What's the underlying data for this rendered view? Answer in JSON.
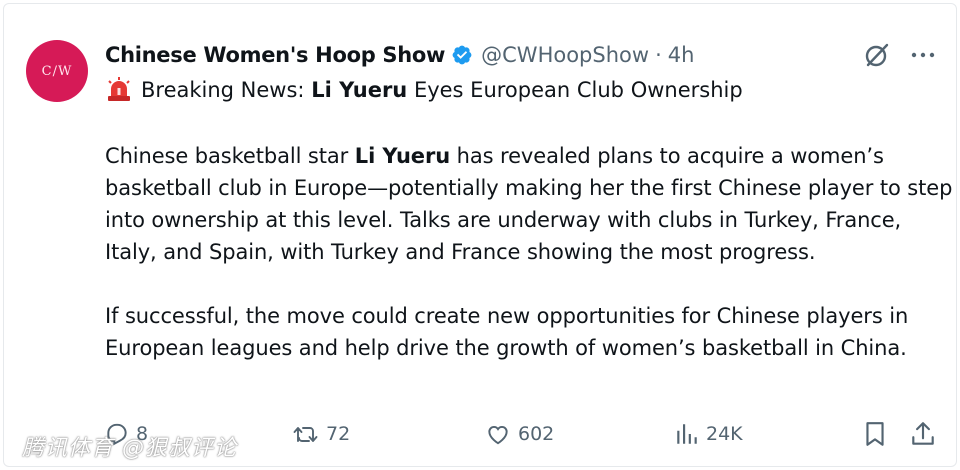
{
  "tweet": {
    "avatar_text": "C/W",
    "display_name": "Chinese Women's Hoop Show",
    "handle": "@CWHoopShow",
    "separator": "·",
    "time": "4h",
    "headline_prefix": "Breaking News: ",
    "headline_bold": "Li Yueru",
    "headline_rest": " Eyes European Club Ownership",
    "p1_start": "Chinese basketball star ",
    "p1_bold": "Li Yueru",
    "p1_rest": " has revealed plans to acquire a women’s basketball club in Europe—potentially making her the first Chinese player to step into ownership at this level. Talks are underway with clubs in Turkey, France, Italy, and Spain, with Turkey and France showing the most progress.",
    "p2": "If successful, the move could create new opportunities for Chinese players in European leagues and help drive the growth of women’s basketball in China."
  },
  "actions": {
    "replies": "8",
    "reposts": "72",
    "likes": "602",
    "views": "24K"
  },
  "watermark": "腾讯体育 @狠叔评论",
  "colors": {
    "avatar_bg": "#d61a57",
    "verified": "#1d9bf0",
    "muted": "#536471",
    "text": "#0f1419"
  },
  "icons": [
    "verified-badge-icon",
    "grok-icon",
    "more-options-icon",
    "siren-icon",
    "reply-icon",
    "repost-icon",
    "like-icon",
    "views-icon",
    "bookmark-icon",
    "share-icon"
  ]
}
